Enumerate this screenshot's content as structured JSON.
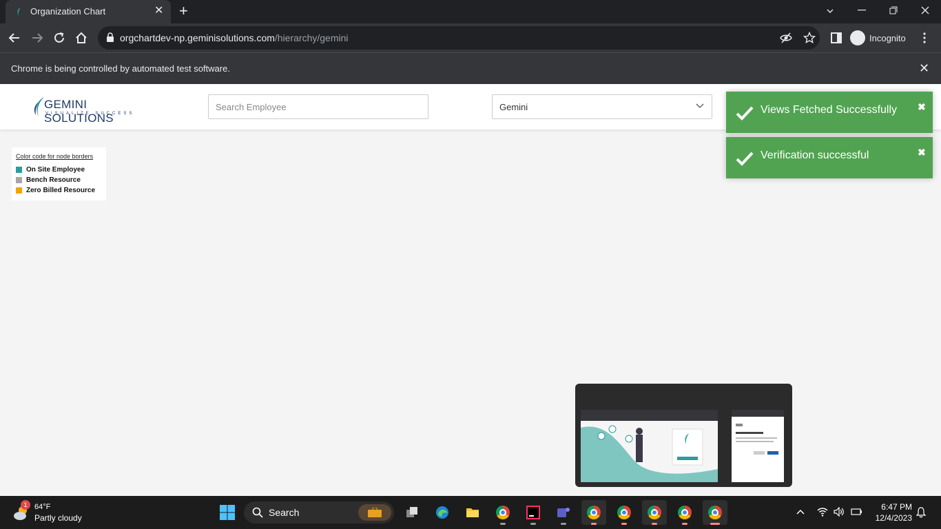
{
  "browser": {
    "tab_title": "Organization Chart",
    "tab_close": "✕",
    "new_tab": "+",
    "url_host": "orgchartdev-np.geminisolutions.com",
    "url_path": "/hierarchy/gemini",
    "profile_label": "Incognito",
    "infobar_text": "Chrome is being controlled by automated test software.",
    "infobar_close": "✕"
  },
  "app": {
    "logo_name_bold": "GEMINI",
    "logo_name": " SOLUTIONS",
    "logo_tagline": "VISUALIZE SUCCESS",
    "search_placeholder": "Search Employee",
    "org_select_value": "Gemini"
  },
  "legend": {
    "title": "Color code for node borders",
    "items": [
      {
        "label": "On Site Employee",
        "color": "#2a9d9d"
      },
      {
        "label": "Bench Resource",
        "color": "#a6a6a6"
      },
      {
        "label": "Zero Billed Resource",
        "color": "#f5a300"
      }
    ]
  },
  "toasts": [
    {
      "message": "Views Fetched Successfully",
      "close": "✖"
    },
    {
      "message": "Verification successful",
      "close": "✖"
    }
  ],
  "taskbar": {
    "weather_temp": "64°F",
    "weather_condition": "Partly cloudy",
    "weather_badge": "1",
    "search_label": "Search",
    "time": "6:47 PM",
    "date": "12/4/2023"
  },
  "colors": {
    "toast_green": "#51a351",
    "brand_navy": "#1f3a68",
    "brand_teal": "#2a9d9d"
  }
}
